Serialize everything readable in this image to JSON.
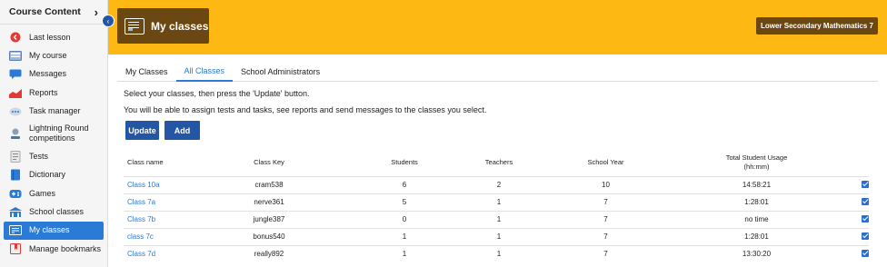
{
  "sidebar": {
    "header": "Course Content",
    "items": [
      {
        "label": "Last lesson",
        "icon": "last-lesson-icon"
      },
      {
        "label": "My course",
        "icon": "course-icon"
      },
      {
        "label": "Messages",
        "icon": "messages-icon"
      },
      {
        "label": "Reports",
        "icon": "reports-icon"
      },
      {
        "label": "Task manager",
        "icon": "task-manager-icon"
      },
      {
        "label": "Lightning Round competitions",
        "icon": "lightning-round-icon"
      },
      {
        "label": "Tests",
        "icon": "tests-icon"
      },
      {
        "label": "Dictionary",
        "icon": "dictionary-icon"
      },
      {
        "label": "Games",
        "icon": "games-icon"
      },
      {
        "label": "School classes",
        "icon": "school-classes-icon"
      },
      {
        "label": "My classes",
        "icon": "my-classes-icon"
      },
      {
        "label": "Manage bookmarks",
        "icon": "bookmarks-icon"
      }
    ]
  },
  "header": {
    "title": "My classes",
    "course": "Lower Secondary Mathematics 7"
  },
  "tabs": [
    "My Classes",
    "All Classes",
    "School Administrators"
  ],
  "active_tab": "All Classes",
  "intro": {
    "line1": "Select your classes, then press the 'Update' button.",
    "line2": "You will be able to assign tests and tasks, see reports and send messages to the classes you select."
  },
  "buttons": {
    "update": "Update",
    "add": "Add"
  },
  "table": {
    "headers": {
      "name": "Class name",
      "key": "Class Key",
      "students": "Students",
      "teachers": "Teachers",
      "year": "School Year",
      "usage": "Total Student Usage",
      "usage_unit": "(hh:mm)"
    },
    "rows": [
      {
        "name": "Class 10a",
        "key": "cram538",
        "students": "6",
        "teachers": "2",
        "year": "10",
        "usage": "14:58:21"
      },
      {
        "name": "Class 7a",
        "key": "nerve361",
        "students": "5",
        "teachers": "1",
        "year": "7",
        "usage": "1:28:01"
      },
      {
        "name": "Class 7b",
        "key": "jungle387",
        "students": "0",
        "teachers": "1",
        "year": "7",
        "usage": "no time"
      },
      {
        "name": "class 7c",
        "key": "bonus540",
        "students": "1",
        "teachers": "1",
        "year": "7",
        "usage": "1:28:01"
      },
      {
        "name": "Class 7d",
        "key": "really892",
        "students": "1",
        "teachers": "1",
        "year": "7",
        "usage": "13:30:20"
      }
    ]
  }
}
